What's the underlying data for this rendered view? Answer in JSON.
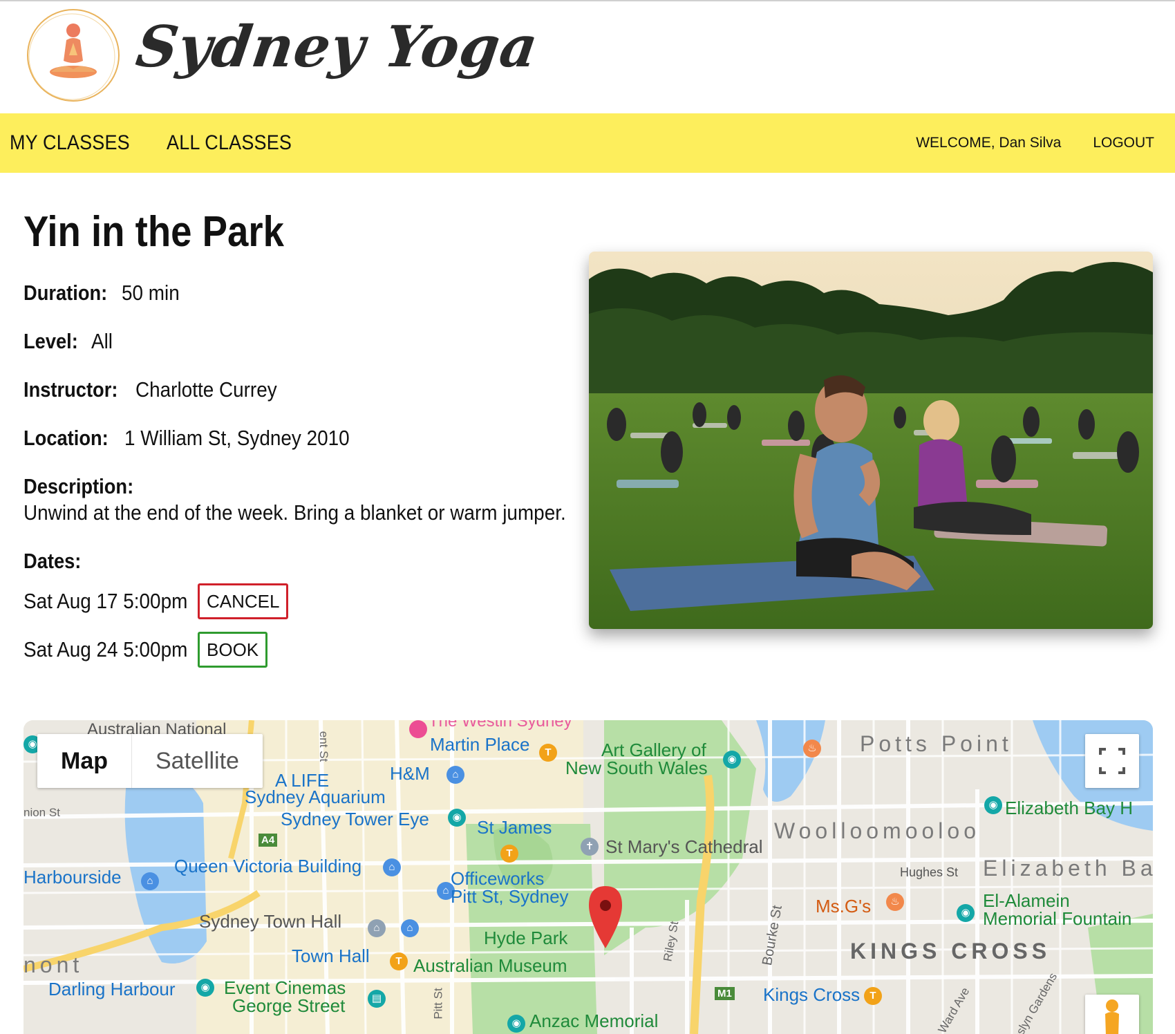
{
  "header": {
    "brand": "Sydney Yoga"
  },
  "nav": {
    "my_classes": "MY CLASSES",
    "all_classes": "ALL CLASSES",
    "welcome_prefix": "WELCOME, ",
    "user_name": "Dan Silva",
    "logout": "LOGOUT"
  },
  "class": {
    "title": "Yin in the Park",
    "duration_label": "Duration:",
    "duration_value": "50 min",
    "level_label": "Level:",
    "level_value": "All",
    "instructor_label": "Instructor:",
    "instructor_value": "Charlotte Currey",
    "location_label": "Location:",
    "location_value": "1 William St, Sydney 2010",
    "description_label": "Description:",
    "description_value": "Unwind at the end of the week. Bring a blanket or warm jumper.",
    "dates_label": "Dates:",
    "dates": [
      {
        "text": "Sat Aug 17 5:00pm",
        "action": "CANCEL"
      },
      {
        "text": "Sat Aug 24 5:00pm",
        "action": "BOOK"
      }
    ]
  },
  "map": {
    "type_map": "Map",
    "type_satellite": "Satellite",
    "labels": {
      "australian_national": "Australian National",
      "westin": "The Westin Sydney",
      "martin_place": "Martin Place",
      "art_gallery_1": "Art Gallery of",
      "art_gallery_2": "New South Wales",
      "potts_point": "Potts Point",
      "sea_life_1": "A LIFE",
      "sea_life_2": "Sydney Aquarium",
      "hm": "H&M",
      "sydney_tower_eye": "Sydney Tower Eye",
      "st_james": "St James",
      "st_marys": "St Mary's Cathedral",
      "woolloomooloo": "Woolloomooloo",
      "elizabeth_bay_h": "Elizabeth Bay H",
      "harbourside": "Harbourside",
      "qvb": "Queen Victoria Building",
      "officeworks_1": "Officeworks",
      "officeworks_2": "Pitt St, Sydney",
      "hughes_st": "Hughes St",
      "elizabeth_ba": "Elizabeth Ba",
      "ms_gs": "Ms.G's",
      "el_alamein_1": "El-Alamein",
      "el_alamein_2": "Memorial Fountain",
      "town_hall_building": "Sydney Town Hall",
      "hyde_park": "Hyde Park",
      "kings_cross_district": "KINGS CROSS",
      "town_hall": "Town Hall",
      "australian_museum": "Australian Museum",
      "pyrmont": "nont",
      "darling_harbour": "Darling Harbour",
      "event_cinemas_1": "Event Cinemas",
      "event_cinemas_2": "George Street",
      "kings_cross": "Kings Cross",
      "anzac_memorial": "Anzac Memorial",
      "riley_st": "Riley St",
      "bourke_st": "Bourke St",
      "ward_ave": "Ward Ave",
      "roslyn_gardens": "Roslyn Gardens",
      "pitt_st": "Pitt St",
      "ent_st": "ent St",
      "nion_st": "nion St",
      "a4": "A4",
      "m1": "M1"
    }
  }
}
